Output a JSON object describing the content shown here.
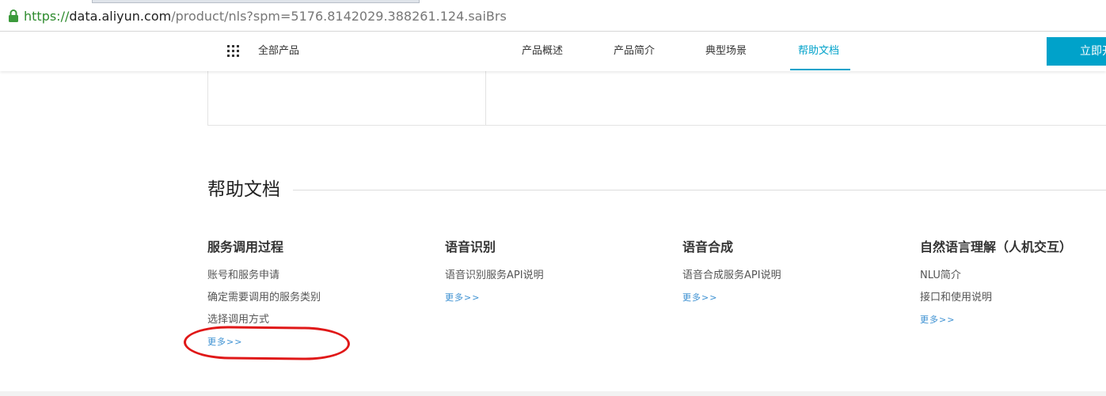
{
  "browser": {
    "lock_icon": "padlock-icon",
    "url_scheme": "https://",
    "url_host": "data.aliyun.com",
    "url_path": "/product/nls?spm=5176.8142029.388261.124.saiBrs"
  },
  "nav": {
    "menu_icon": "grid-icon",
    "all_products": "全部产品",
    "items": [
      {
        "label": "产品概述",
        "active": false
      },
      {
        "label": "产品简介",
        "active": false
      },
      {
        "label": "典型场景",
        "active": false
      },
      {
        "label": "帮助文档",
        "active": true
      }
    ],
    "cta": "立即开"
  },
  "help": {
    "title": "帮助文档",
    "columns": [
      {
        "title": "服务调用过程",
        "links": [
          "账号和服务申请",
          "确定需要调用的服务类别",
          "选择调用方式"
        ],
        "more": "更多>>"
      },
      {
        "title": "语音识别",
        "links": [
          "语音识别服务API说明"
        ],
        "more": "更多>>"
      },
      {
        "title": "语音合成",
        "links": [
          "语音合成服务API说明"
        ],
        "more": "更多>>"
      },
      {
        "title": "自然语言理解（人机交互）",
        "links": [
          "NLU简介",
          "接口和使用说明"
        ],
        "more": "更多>>"
      }
    ]
  },
  "colors": {
    "accent": "#00a2ca",
    "link": "#3a8fd1",
    "annotation": "#e01818",
    "url_scheme": "#2e8b2e"
  }
}
